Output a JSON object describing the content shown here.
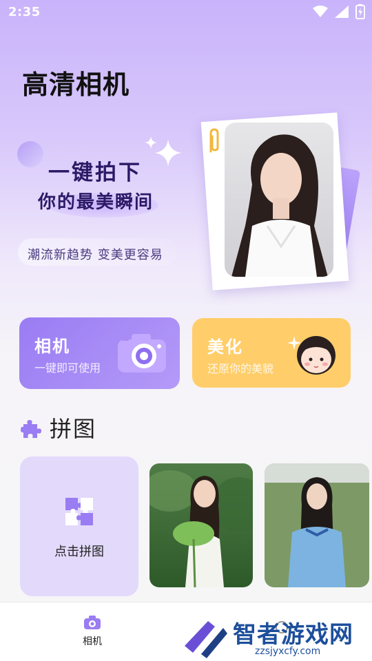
{
  "status_bar": {
    "time": "2:35"
  },
  "app": {
    "title": "高清相机"
  },
  "banner": {
    "headline_line1": "一键拍下",
    "headline_line2": "你的最美瞬间",
    "tagline": "潮流新趋势  变美更容易"
  },
  "feature_cards": [
    {
      "title": "相机",
      "subtitle": "一键即可使用",
      "icon": "camera-icon",
      "color": "#9a7cf3"
    },
    {
      "title": "美化",
      "subtitle": "还原你的美貌",
      "icon": "girl-face-icon",
      "color": "#ffcd69"
    }
  ],
  "puzzle_section": {
    "title": "拼图",
    "icon": "puzzle-piece-icon",
    "tile_label": "点击拼图"
  },
  "bottom_nav": {
    "items": [
      {
        "label": "相机",
        "icon": "camera-icon",
        "active": true
      }
    ]
  },
  "watermark": {
    "brand": "智者游戏网",
    "url": "zzsjyxcfy.com"
  },
  "colors": {
    "accent": "#9a7cf3",
    "accent_yellow": "#ffcd69",
    "dark_text": "#2c1a66"
  }
}
